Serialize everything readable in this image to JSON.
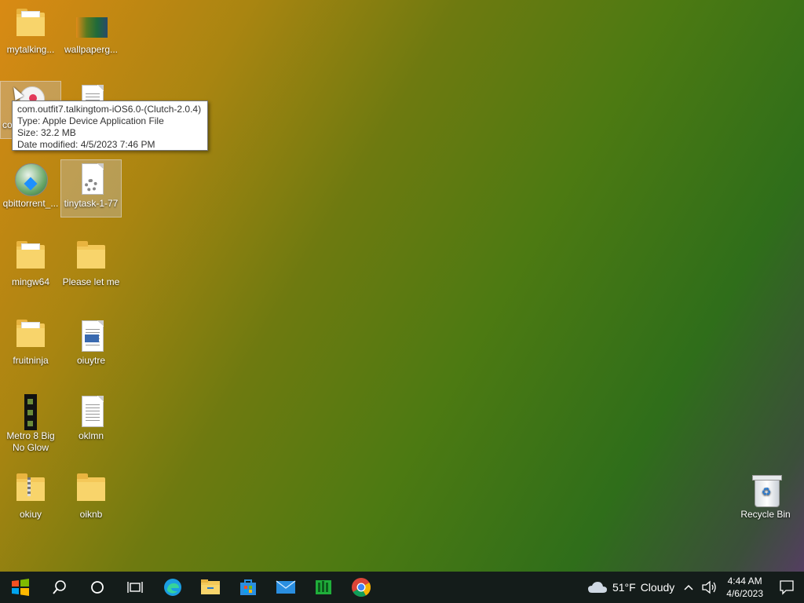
{
  "desktop": {
    "icons": [
      {
        "label": "mytalking..."
      },
      {
        "label": "wallpaperg..."
      },
      {
        "label": "co"
      },
      {
        "label": ""
      },
      {
        "label": "qbittorrent_..."
      },
      {
        "label": "tinytask-1-77"
      },
      {
        "label": "mingw64"
      },
      {
        "label": "Please let me"
      },
      {
        "label": "fruitninja"
      },
      {
        "label": "oiuytre"
      },
      {
        "label": "Metro 8 Big No Glow"
      },
      {
        "label": "oklmn"
      },
      {
        "label": "okiuy"
      },
      {
        "label": "oiknb"
      },
      {
        "label": "Recycle Bin"
      }
    ]
  },
  "tooltip": {
    "name": "com.outfit7.talkingtom-iOS6.0-(Clutch-2.0.4)",
    "type": "Type: Apple Device Application File",
    "size": "Size: 32.2 MB",
    "modified": "Date modified: 4/5/2023 7:46 PM"
  },
  "taskbar": {
    "weather_temp": "51°F",
    "weather_desc": "Cloudy",
    "time": "4:44 AM",
    "date": "4/6/2023"
  },
  "colors": {
    "taskbar": "#141c1a",
    "windows_blue": "#1e90ff"
  }
}
